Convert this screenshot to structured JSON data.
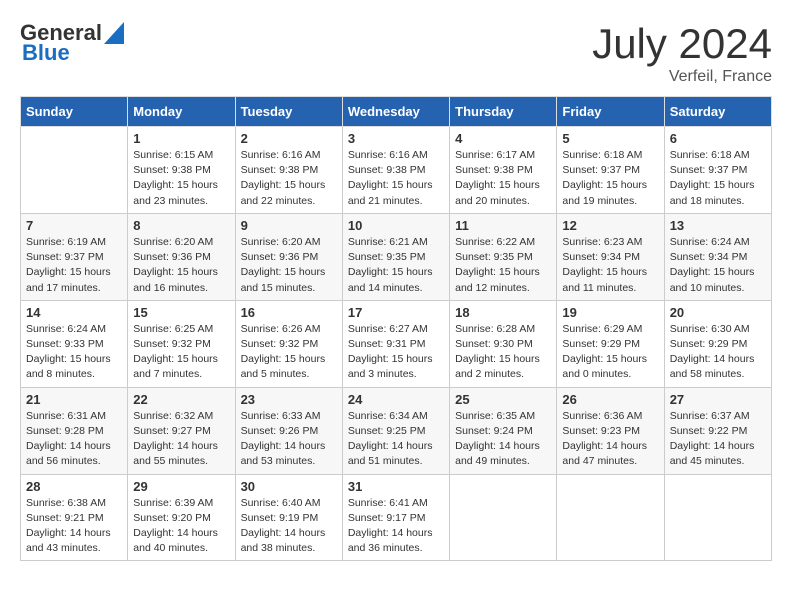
{
  "header": {
    "logo_general": "General",
    "logo_blue": "Blue",
    "month_title": "July 2024",
    "location": "Verfeil, France"
  },
  "days_of_week": [
    "Sunday",
    "Monday",
    "Tuesday",
    "Wednesday",
    "Thursday",
    "Friday",
    "Saturday"
  ],
  "weeks": [
    [
      {
        "day": "",
        "sunrise": "",
        "sunset": "",
        "daylight": ""
      },
      {
        "day": "1",
        "sunrise": "Sunrise: 6:15 AM",
        "sunset": "Sunset: 9:38 PM",
        "daylight": "Daylight: 15 hours and 23 minutes."
      },
      {
        "day": "2",
        "sunrise": "Sunrise: 6:16 AM",
        "sunset": "Sunset: 9:38 PM",
        "daylight": "Daylight: 15 hours and 22 minutes."
      },
      {
        "day": "3",
        "sunrise": "Sunrise: 6:16 AM",
        "sunset": "Sunset: 9:38 PM",
        "daylight": "Daylight: 15 hours and 21 minutes."
      },
      {
        "day": "4",
        "sunrise": "Sunrise: 6:17 AM",
        "sunset": "Sunset: 9:38 PM",
        "daylight": "Daylight: 15 hours and 20 minutes."
      },
      {
        "day": "5",
        "sunrise": "Sunrise: 6:18 AM",
        "sunset": "Sunset: 9:37 PM",
        "daylight": "Daylight: 15 hours and 19 minutes."
      },
      {
        "day": "6",
        "sunrise": "Sunrise: 6:18 AM",
        "sunset": "Sunset: 9:37 PM",
        "daylight": "Daylight: 15 hours and 18 minutes."
      }
    ],
    [
      {
        "day": "7",
        "sunrise": "Sunrise: 6:19 AM",
        "sunset": "Sunset: 9:37 PM",
        "daylight": "Daylight: 15 hours and 17 minutes."
      },
      {
        "day": "8",
        "sunrise": "Sunrise: 6:20 AM",
        "sunset": "Sunset: 9:36 PM",
        "daylight": "Daylight: 15 hours and 16 minutes."
      },
      {
        "day": "9",
        "sunrise": "Sunrise: 6:20 AM",
        "sunset": "Sunset: 9:36 PM",
        "daylight": "Daylight: 15 hours and 15 minutes."
      },
      {
        "day": "10",
        "sunrise": "Sunrise: 6:21 AM",
        "sunset": "Sunset: 9:35 PM",
        "daylight": "Daylight: 15 hours and 14 minutes."
      },
      {
        "day": "11",
        "sunrise": "Sunrise: 6:22 AM",
        "sunset": "Sunset: 9:35 PM",
        "daylight": "Daylight: 15 hours and 12 minutes."
      },
      {
        "day": "12",
        "sunrise": "Sunrise: 6:23 AM",
        "sunset": "Sunset: 9:34 PM",
        "daylight": "Daylight: 15 hours and 11 minutes."
      },
      {
        "day": "13",
        "sunrise": "Sunrise: 6:24 AM",
        "sunset": "Sunset: 9:34 PM",
        "daylight": "Daylight: 15 hours and 10 minutes."
      }
    ],
    [
      {
        "day": "14",
        "sunrise": "Sunrise: 6:24 AM",
        "sunset": "Sunset: 9:33 PM",
        "daylight": "Daylight: 15 hours and 8 minutes."
      },
      {
        "day": "15",
        "sunrise": "Sunrise: 6:25 AM",
        "sunset": "Sunset: 9:32 PM",
        "daylight": "Daylight: 15 hours and 7 minutes."
      },
      {
        "day": "16",
        "sunrise": "Sunrise: 6:26 AM",
        "sunset": "Sunset: 9:32 PM",
        "daylight": "Daylight: 15 hours and 5 minutes."
      },
      {
        "day": "17",
        "sunrise": "Sunrise: 6:27 AM",
        "sunset": "Sunset: 9:31 PM",
        "daylight": "Daylight: 15 hours and 3 minutes."
      },
      {
        "day": "18",
        "sunrise": "Sunrise: 6:28 AM",
        "sunset": "Sunset: 9:30 PM",
        "daylight": "Daylight: 15 hours and 2 minutes."
      },
      {
        "day": "19",
        "sunrise": "Sunrise: 6:29 AM",
        "sunset": "Sunset: 9:29 PM",
        "daylight": "Daylight: 15 hours and 0 minutes."
      },
      {
        "day": "20",
        "sunrise": "Sunrise: 6:30 AM",
        "sunset": "Sunset: 9:29 PM",
        "daylight": "Daylight: 14 hours and 58 minutes."
      }
    ],
    [
      {
        "day": "21",
        "sunrise": "Sunrise: 6:31 AM",
        "sunset": "Sunset: 9:28 PM",
        "daylight": "Daylight: 14 hours and 56 minutes."
      },
      {
        "day": "22",
        "sunrise": "Sunrise: 6:32 AM",
        "sunset": "Sunset: 9:27 PM",
        "daylight": "Daylight: 14 hours and 55 minutes."
      },
      {
        "day": "23",
        "sunrise": "Sunrise: 6:33 AM",
        "sunset": "Sunset: 9:26 PM",
        "daylight": "Daylight: 14 hours and 53 minutes."
      },
      {
        "day": "24",
        "sunrise": "Sunrise: 6:34 AM",
        "sunset": "Sunset: 9:25 PM",
        "daylight": "Daylight: 14 hours and 51 minutes."
      },
      {
        "day": "25",
        "sunrise": "Sunrise: 6:35 AM",
        "sunset": "Sunset: 9:24 PM",
        "daylight": "Daylight: 14 hours and 49 minutes."
      },
      {
        "day": "26",
        "sunrise": "Sunrise: 6:36 AM",
        "sunset": "Sunset: 9:23 PM",
        "daylight": "Daylight: 14 hours and 47 minutes."
      },
      {
        "day": "27",
        "sunrise": "Sunrise: 6:37 AM",
        "sunset": "Sunset: 9:22 PM",
        "daylight": "Daylight: 14 hours and 45 minutes."
      }
    ],
    [
      {
        "day": "28",
        "sunrise": "Sunrise: 6:38 AM",
        "sunset": "Sunset: 9:21 PM",
        "daylight": "Daylight: 14 hours and 43 minutes."
      },
      {
        "day": "29",
        "sunrise": "Sunrise: 6:39 AM",
        "sunset": "Sunset: 9:20 PM",
        "daylight": "Daylight: 14 hours and 40 minutes."
      },
      {
        "day": "30",
        "sunrise": "Sunrise: 6:40 AM",
        "sunset": "Sunset: 9:19 PM",
        "daylight": "Daylight: 14 hours and 38 minutes."
      },
      {
        "day": "31",
        "sunrise": "Sunrise: 6:41 AM",
        "sunset": "Sunset: 9:17 PM",
        "daylight": "Daylight: 14 hours and 36 minutes."
      },
      {
        "day": "",
        "sunrise": "",
        "sunset": "",
        "daylight": ""
      },
      {
        "day": "",
        "sunrise": "",
        "sunset": "",
        "daylight": ""
      },
      {
        "day": "",
        "sunrise": "",
        "sunset": "",
        "daylight": ""
      }
    ]
  ]
}
